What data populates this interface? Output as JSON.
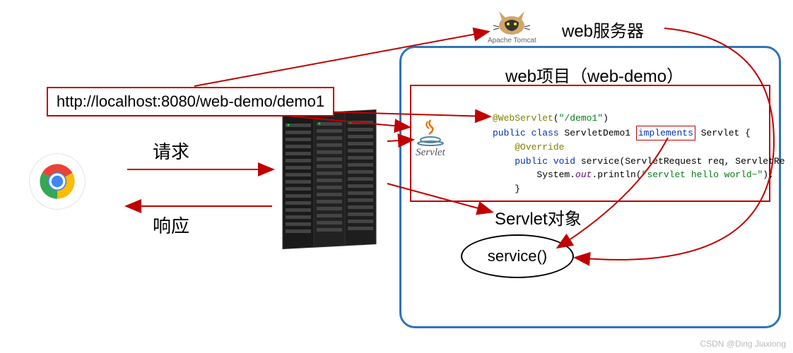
{
  "url": "http://localhost:8080/web-demo/demo1",
  "labels": {
    "request": "请求",
    "response": "响应",
    "webserver": "web服务器",
    "webproject": "web项目（web-demo）",
    "servletobj": "Servlet对象",
    "service": "service()"
  },
  "tomcat_caption": "Apache Tomcat",
  "servlet_caption": "Servlet",
  "code": {
    "line1_anno": "@WebServlet",
    "line1_path": "\"/demo1\"",
    "line2_pre": "public class",
    "line2_name": "ServletDemo1",
    "line2_impl": "implements",
    "line2_srv": "Servlet {",
    "line3": "@Override",
    "line4_pre": "public void",
    "line4_method": "service",
    "line4_args": "(ServletRequest req, ServletRe",
    "line5_pre": "System.",
    "line5_out": "out",
    "line5_call": ".println(",
    "line5_str": "\"servlet hello world~\"",
    "line5_end": ");",
    "line6": "}"
  },
  "watermark": "CSDN @Ding Jiaxiong"
}
